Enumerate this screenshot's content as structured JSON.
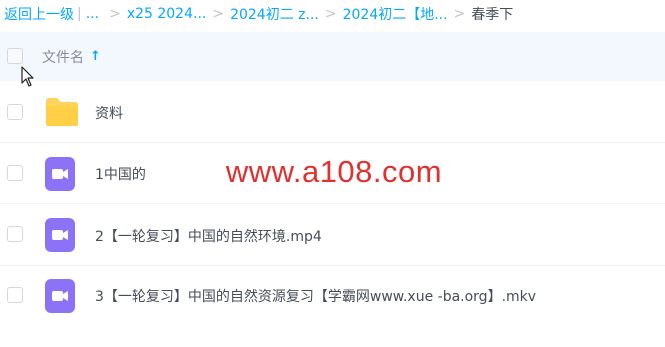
{
  "breadcrumb": {
    "back": "返回上一级",
    "pipe": "|",
    "items": [
      "...",
      "x25 2024...",
      "2024初二 z...",
      "2024初二【地..."
    ],
    "current": "春季下",
    "separator": ">"
  },
  "header": {
    "column_title": "文件名",
    "sort_arrow": "↑"
  },
  "files": [
    {
      "name": "资料",
      "type": "folder-icon"
    },
    {
      "name": "1中国的",
      "type": "video-icon"
    },
    {
      "name": "2【一轮复习】中国的自然环境.mp4",
      "type": "video-icon"
    },
    {
      "name": "3【一轮复习】中国的自然资源复习【学霸网www.xue -ba.org】.mkv",
      "type": "video-icon"
    }
  ],
  "watermark": "www.a108.com",
  "colors": {
    "accent": "#06a7ff",
    "folder": "#ffd45a",
    "video": "#8b72f6",
    "watermark": "#e03131",
    "header_bg": "#f3f8ff"
  }
}
